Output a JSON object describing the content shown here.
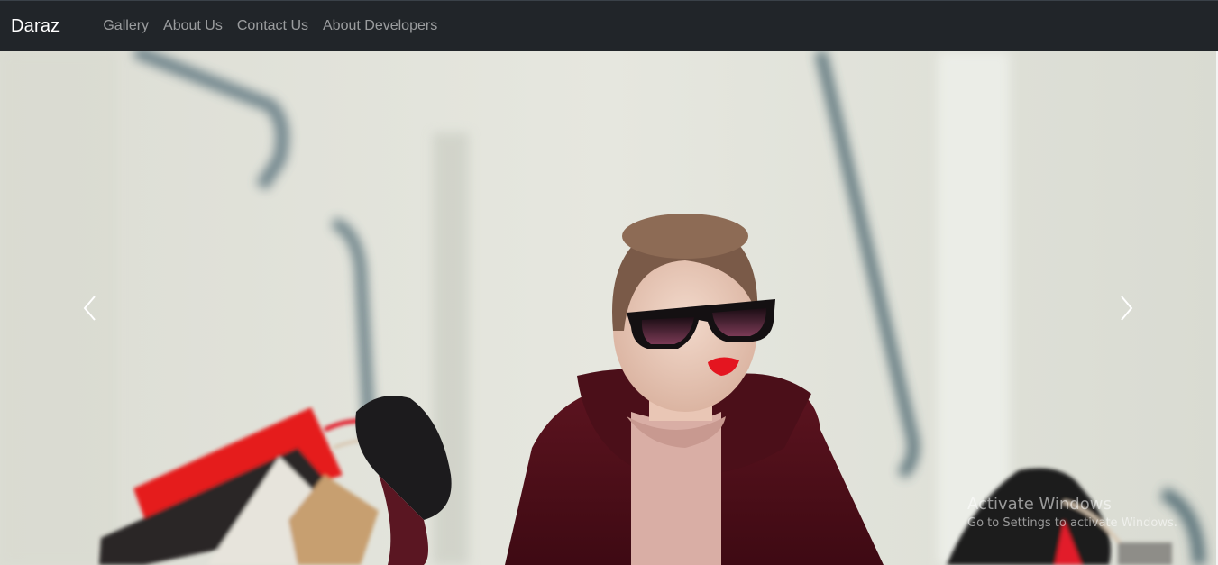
{
  "navbar": {
    "brand": "Daraz",
    "links": [
      {
        "label": "Gallery"
      },
      {
        "label": "About Us"
      },
      {
        "label": "Contact Us"
      },
      {
        "label": "About Developers"
      }
    ]
  },
  "carousel": {
    "prev_icon": "chevron-left-icon",
    "next_icon": "chevron-right-icon"
  },
  "watermark": {
    "title": "Activate Windows",
    "subtitle": "Go to Settings to activate Windows."
  },
  "colors": {
    "navbar_bg": "#212529",
    "brand_text": "#ffffff",
    "nav_link_text": "#a8aaad",
    "image_bg": "#dfe0d8"
  }
}
